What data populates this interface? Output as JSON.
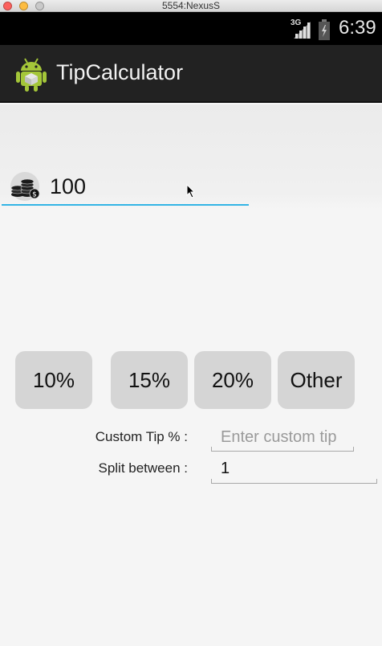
{
  "window": {
    "title": "5554:NexusS"
  },
  "status_bar": {
    "network": "3G",
    "time": "6:39"
  },
  "action_bar": {
    "title": "TipCalculator"
  },
  "amount": {
    "value": "100"
  },
  "tip_buttons": [
    {
      "label": "10%"
    },
    {
      "label": "15%"
    },
    {
      "label": "20%"
    },
    {
      "label": "Other"
    }
  ],
  "custom_tip": {
    "label": "Custom Tip % :",
    "placeholder": "Enter custom tip",
    "value": ""
  },
  "split": {
    "label": "Split between :",
    "value": "1"
  },
  "colors": {
    "accent": "#33b5e5",
    "action_bar": "#222222",
    "status_bar": "#000000",
    "button": "#d5d5d5"
  },
  "icons": [
    "android-app-icon",
    "coins-icon",
    "signal-icon",
    "battery-icon",
    "mouse-cursor-icon"
  ]
}
